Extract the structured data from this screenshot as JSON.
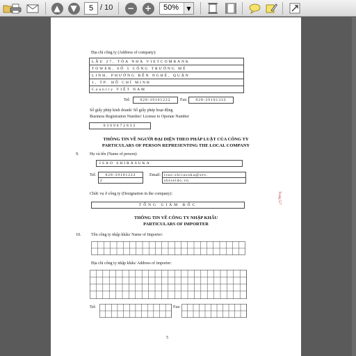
{
  "toolbar": {
    "page_current": "5",
    "page_total": "/ 10",
    "zoom": "50%",
    "icons": [
      "folder-icon",
      "print-icon",
      "email-icon",
      "previous-page-icon",
      "next-page-icon",
      "zoom-out-icon",
      "zoom-in-icon",
      "fit-page-icon",
      "fit-width-icon",
      "comment-icon",
      "highlight-icon",
      "fullscreen-icon"
    ]
  },
  "document": {
    "address_label": "Địa chỉ công ty (Address of company):",
    "address_line1": "LẦU 27, TÒA NHÀ VIETCOMBANK",
    "address_line2": "TOWER, SỐ 5 CÔNG TRƯỜNG MÊ",
    "address_line3": "LINH, PHƯỜNG BẾN NGHÉ, QUẬN",
    "address_line4": "1, TP. HỒ CHÍ MINH",
    "address_line5": "Country VIỆT NAM",
    "tel_label": "Tel:",
    "tel_value": "028-39101222",
    "fax_label": "Fax:",
    "fax_value": "028-39101333",
    "license_label1": "Số giấy phép kinh doanh/ Số giấy phép hoạt động",
    "license_label2": "Business Registration Number/ License to Operate Number",
    "license_value": "0309672832",
    "heading1_vn": "THÔNG TIN VỀ NGƯỜI ĐẠI DIỆN THEO PHÁP LUẬT CỦA CÔNG TY",
    "heading1_en": "PARTICULARS OF PERSON REPRESENTING THE LOCAL COMPANY",
    "item9_num": "9.",
    "name_label": "Họ và tên (Name of person):",
    "name_value": "ISAO SHIRASUKA",
    "rep_tel_label": "Tel:",
    "rep_tel_value": "028-39101222",
    "rep_tel_ext": "2",
    "email_label": "Email:",
    "email_value1": "isao.shirasuka@sev.",
    "email_value2": "shiseido.vn",
    "position_label": "Chức vụ ở công ty (Designation in the company):",
    "position_value": "TỔNG GIÁM ĐỐC",
    "heading2_vn": "THÔNG TIN VỀ CÔNG TY NHẬP KHẨU",
    "heading2_en": "PARTICULARS OF IMPORTER",
    "item10_num": "10.",
    "importer_name_label": "Tên công ty nhập khẩu/ Name of Importer:",
    "importer_address_label": "Địa chỉ công ty nhập khẩu/ Address of importer:",
    "importer_tel_label": "Tel:",
    "importer_fax_label": "Fax:",
    "page_number": "5",
    "side_stamp": "Trang 5/7"
  }
}
